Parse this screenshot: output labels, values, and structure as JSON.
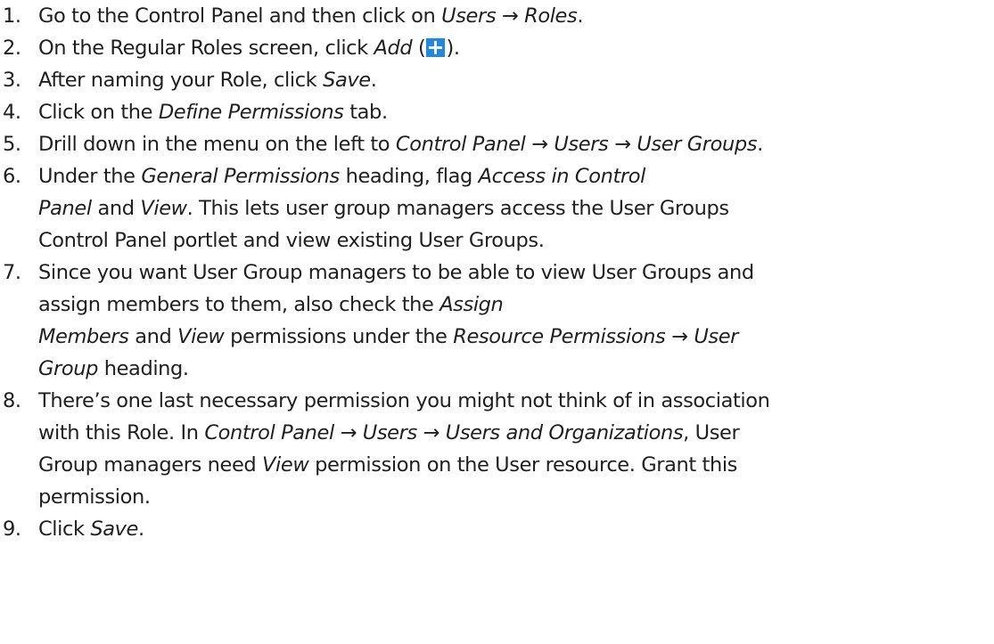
{
  "steps": [
    {
      "num": "1.",
      "parts": [
        {
          "t": "Go to the Control Panel and then click on "
        },
        {
          "t": "Users → Roles",
          "i": true
        },
        {
          "t": "."
        }
      ]
    },
    {
      "num": "2.",
      "parts": [
        {
          "t": "On the Regular Roles screen, click "
        },
        {
          "t": "Add",
          "i": true
        },
        {
          "t": " ("
        },
        {
          "icon": "add-plus-icon"
        },
        {
          "t": ")."
        }
      ]
    },
    {
      "num": "3.",
      "parts": [
        {
          "t": "After naming your Role, click "
        },
        {
          "t": "Save",
          "i": true
        },
        {
          "t": "."
        }
      ]
    },
    {
      "num": "4.",
      "parts": [
        {
          "t": "Click on the "
        },
        {
          "t": "Define Permissions",
          "i": true
        },
        {
          "t": " tab."
        }
      ]
    },
    {
      "num": "5.",
      "parts": [
        {
          "t": "Drill down in the menu on the left to "
        },
        {
          "t": "Control Panel → Users → User Groups",
          "i": true
        },
        {
          "t": "."
        }
      ]
    },
    {
      "num": "6.",
      "parts": [
        {
          "t": "Under the "
        },
        {
          "t": "General Permissions",
          "i": true
        },
        {
          "t": " heading, flag "
        },
        {
          "t": "Access in Control",
          "i": true
        },
        {
          "br": true
        },
        {
          "t": "Panel",
          "i": true
        },
        {
          "t": " and "
        },
        {
          "t": "View",
          "i": true
        },
        {
          "t": ". This lets user group managers access the User Groups"
        },
        {
          "br": true
        },
        {
          "t": "Control Panel portlet and view existing User Groups."
        }
      ]
    },
    {
      "num": "7.",
      "parts": [
        {
          "t": "Since you want User Group managers to be able to view User Groups and"
        },
        {
          "br": true
        },
        {
          "t": "assign members to them, also check the "
        },
        {
          "t": "Assign",
          "i": true
        },
        {
          "br": true
        },
        {
          "t": "Members",
          "i": true
        },
        {
          "t": " and "
        },
        {
          "t": "View",
          "i": true
        },
        {
          "t": " permissions under the "
        },
        {
          "t": "Resource Permissions → User",
          "i": true
        },
        {
          "br": true
        },
        {
          "t": "Group",
          "i": true
        },
        {
          "t": " heading."
        }
      ]
    },
    {
      "num": "8.",
      "parts": [
        {
          "t": "There’s one last necessary permission you might not think of in association"
        },
        {
          "br": true
        },
        {
          "t": "with this Role. In "
        },
        {
          "t": "Control Panel → Users → Users and Organizations",
          "i": true
        },
        {
          "t": ", User"
        },
        {
          "br": true
        },
        {
          "t": "Group managers need "
        },
        {
          "t": "View",
          "i": true
        },
        {
          "t": " permission on the User resource. Grant this"
        },
        {
          "br": true
        },
        {
          "t": "permission."
        }
      ]
    },
    {
      "num": "9.",
      "parts": [
        {
          "t": "Click "
        },
        {
          "t": "Save",
          "i": true
        },
        {
          "t": "."
        }
      ]
    }
  ]
}
